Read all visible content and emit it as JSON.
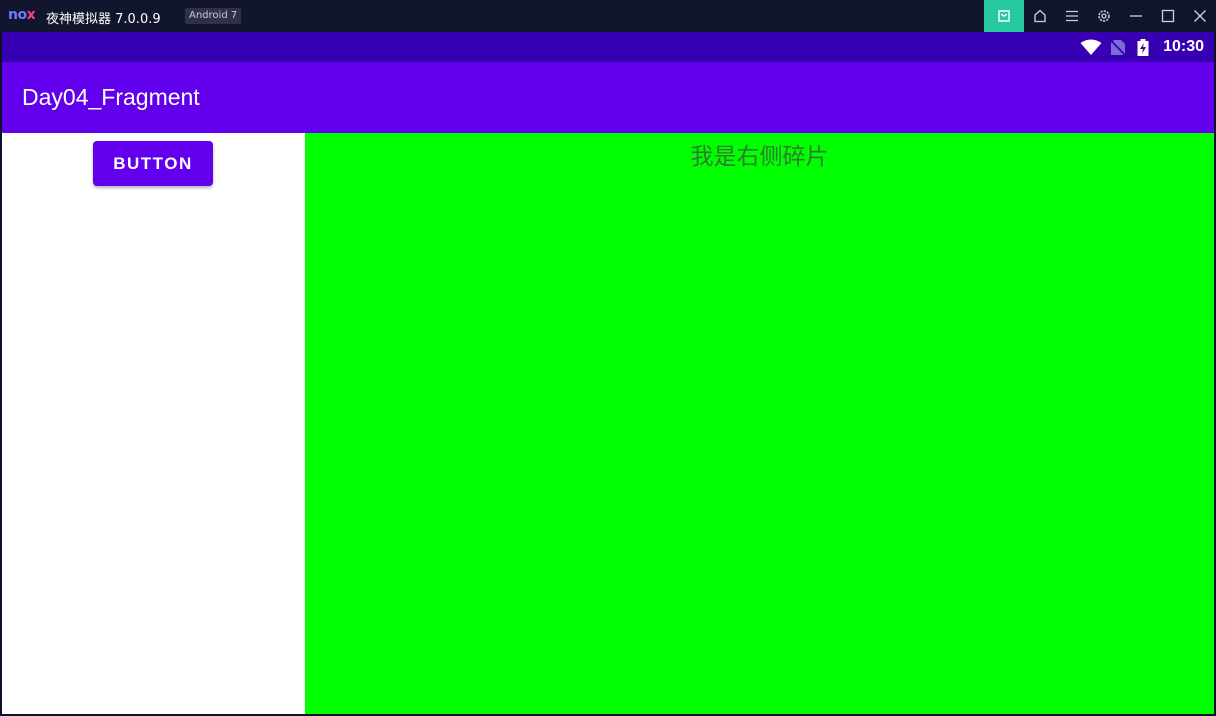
{
  "window": {
    "logo_prefix": "no",
    "logo_x": "x",
    "title": "夜神模拟器 7.0.0.9",
    "badge": "Android 7",
    "buttons": [
      "store-icon",
      "home-icon",
      "menu-icon",
      "settings-icon",
      "minimize-icon",
      "maximize-icon",
      "close-icon"
    ]
  },
  "status_bar": {
    "time": "10:30",
    "icons": [
      "wifi-icon",
      "no-sim-icon",
      "battery-charging-icon"
    ]
  },
  "app_bar": {
    "title": "Day04_Fragment"
  },
  "left_fragment": {
    "button_label": "BUTTON"
  },
  "right_fragment": {
    "text": "我是右侧碎片"
  },
  "colors": {
    "status_bar": "#3700b3",
    "app_bar": "#6200ee",
    "button": "#6200ee",
    "right_fragment": "#00ff00",
    "title_bar": "#12152e",
    "store_button": "#27c9a1"
  }
}
